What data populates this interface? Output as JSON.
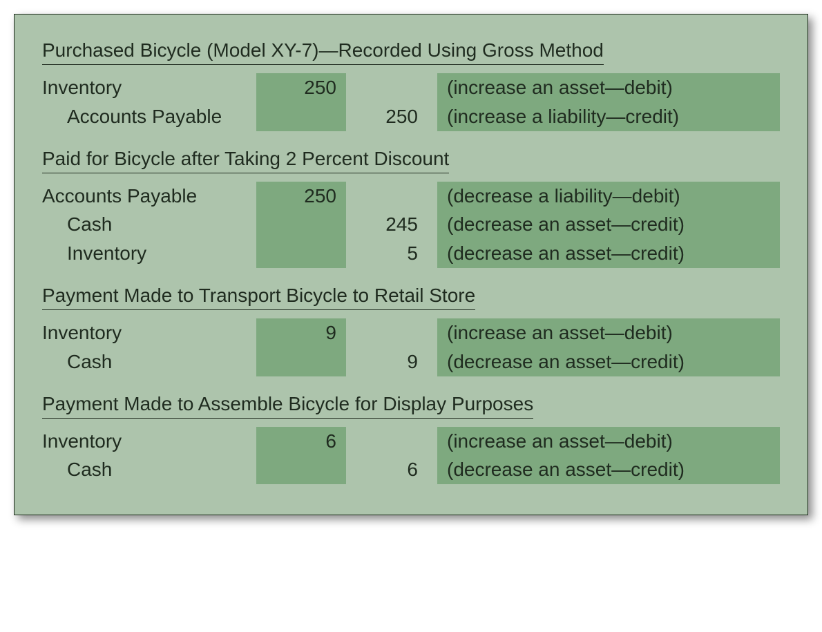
{
  "sections": [
    {
      "title": "Purchased Bicycle (Model XY-7)—Recorded Using Gross Method",
      "lines": [
        {
          "account": "Inventory",
          "indent": false,
          "debit": "250",
          "credit": "",
          "explain": "(increase an asset—debit)"
        },
        {
          "account": "Accounts Payable",
          "indent": true,
          "debit": "",
          "credit": "250",
          "explain": "(increase a liability—credit)"
        }
      ]
    },
    {
      "title": "Paid for Bicycle after Taking 2 Percent Discount",
      "lines": [
        {
          "account": "Accounts Payable",
          "indent": false,
          "debit": "250",
          "credit": "",
          "explain": "(decrease a liability—debit)"
        },
        {
          "account": "Cash",
          "indent": true,
          "debit": "",
          "credit": "245",
          "explain": "(decrease an asset—credit)"
        },
        {
          "account": "Inventory",
          "indent": true,
          "debit": "",
          "credit": "5",
          "explain": "(decrease an asset—credit)"
        }
      ]
    },
    {
      "title": "Payment Made to Transport Bicycle to Retail Store",
      "lines": [
        {
          "account": "Inventory",
          "indent": false,
          "debit": "9",
          "credit": "",
          "explain": "(increase an asset—debit)"
        },
        {
          "account": "Cash",
          "indent": true,
          "debit": "",
          "credit": "9",
          "explain": "(decrease an asset—credit)"
        }
      ]
    },
    {
      "title": "Payment Made to Assemble Bicycle for Display Purposes",
      "lines": [
        {
          "account": "Inventory",
          "indent": false,
          "debit": "6",
          "credit": "",
          "explain": "(increase an asset—debit)"
        },
        {
          "account": "Cash",
          "indent": true,
          "debit": "",
          "credit": "6",
          "explain": "(decrease an asset—credit)"
        }
      ]
    }
  ]
}
